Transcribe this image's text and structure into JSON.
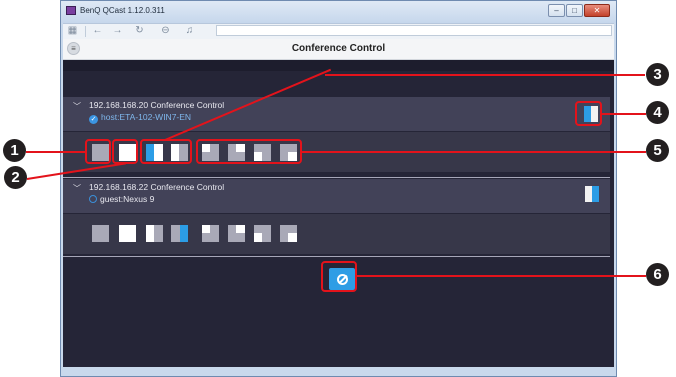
{
  "window": {
    "title": "BenQ QCast 1.12.0.311",
    "controls": [
      "‒",
      "□",
      "✕"
    ]
  },
  "toolbar": {
    "icons": [
      "apps-icon",
      "back-icon",
      "forward-icon",
      "refresh-icon",
      "stop-icon",
      "music-icon"
    ]
  },
  "header": {
    "menu_icon": "hamburger-icon",
    "title": "Conference Control"
  },
  "conferences": [
    {
      "title": "192.168.168.20  Conference Control",
      "participant": "host:ETA-102-WIN7-EN",
      "participant_state": "checked",
      "tiles": [
        "grey",
        "white",
        "split-left-highlight",
        "split-left-white",
        "quad-top-left",
        "quad-top-right",
        "quad-bottom-left",
        "quad-bottom-right"
      ]
    },
    {
      "title": "192.168.168.22  Conference Control",
      "participant": "guest:Nexus 9",
      "participant_state": "unchecked",
      "tiles": [
        "grey",
        "white",
        "split-left-white",
        "split-right-highlight",
        "quad-top-left",
        "quad-top-right",
        "quad-bottom-left",
        "quad-bottom-right"
      ]
    }
  ],
  "actions": {
    "stop_icon": "prohibit-icon"
  },
  "callouts": [
    "1",
    "2",
    "3",
    "4",
    "5",
    "6"
  ],
  "colors": {
    "accent": "#2e9de5",
    "highlight": "#e3131b",
    "panel_dark": "#252537"
  }
}
